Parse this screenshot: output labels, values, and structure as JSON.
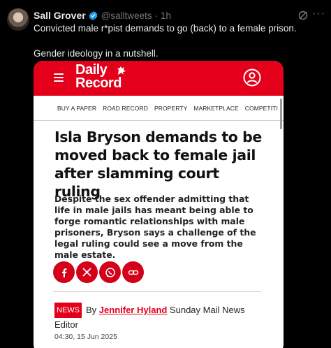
{
  "tweet": {
    "author_name": "Sall Grover",
    "handle": "@salltweets",
    "time": "· 1h",
    "text_line1": "Convicted male r*pist demands to go (back) to a female prison.",
    "text_line2": "Gender ideology in a nutshell.",
    "more_label": "···"
  },
  "card": {
    "logo_line1": "Daily",
    "logo_line2": "Record",
    "nav": [
      "BUY A PAPER",
      "ROAD RECORD",
      "PROPERTY",
      "MARKETPLACE",
      "COMPETITI"
    ],
    "headline": "Isla Bryson demands to be moved back to female jail after slamming court ruling",
    "standfirst": "Despite the sex offender admitting that life in male jails has meant being able to forge romantic relationships with male prisoners, Bryson says a challenge of the legal ruling could see a move from the male estate.",
    "badge": "NEWS",
    "by": "By ",
    "author": "Jennifer Hyland",
    "author_role": " Sunday Mail News Editor",
    "date": "04:30, 15 Jun 2025"
  },
  "colors": {
    "brand_red": "#e4001b",
    "verified_blue": "#1d9bf0",
    "facebook": "#d4001a",
    "x": "#d4001a",
    "whatsapp": "#d4001a",
    "link": "#d4001a"
  },
  "icons": [
    "verified-badge-icon",
    "grok-icon",
    "more-icon",
    "hamburger-icon",
    "lion-icon",
    "account-icon",
    "facebook-icon",
    "x-icon",
    "whatsapp-icon",
    "link-icon"
  ]
}
